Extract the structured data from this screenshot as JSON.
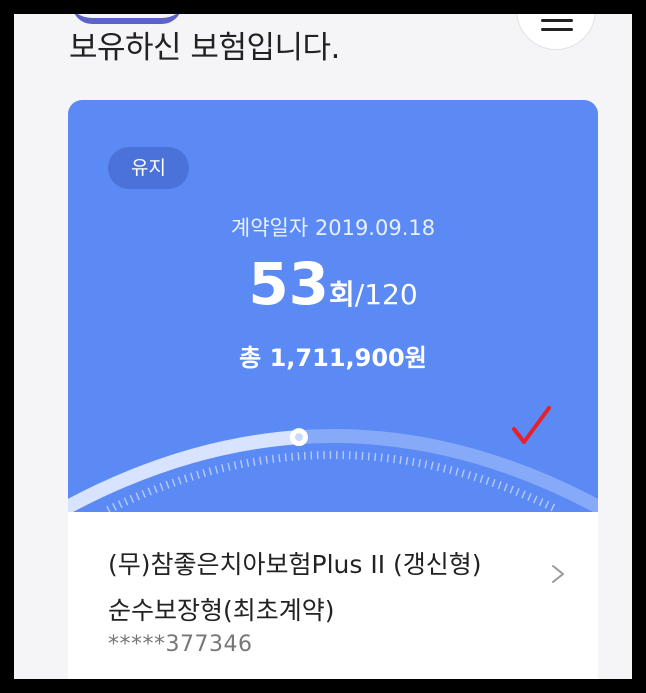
{
  "header": {
    "title": "보유하신 보험입니다."
  },
  "card": {
    "status_badge": "유지",
    "contract_date_label": "계약일자",
    "contract_date": "2019.09.18",
    "paid_count": "53",
    "paid_unit": "회",
    "total_count": "/120",
    "total_prefix": "총",
    "total_amount": "1,711,900",
    "total_suffix": "원",
    "progress_fraction": 0.44,
    "product_name_line1": "(무)참좋은치아보험Plus II (갱신형)",
    "product_name_line2": "순수보장형(최초계약)",
    "policy_number": "*****377346"
  },
  "colors": {
    "card_accent": "#5b8af5",
    "badge": "#4a72d9",
    "check_mark": "#e8202a"
  },
  "icons": {
    "menu": "hamburger-icon",
    "chevron": "chevron-right-icon",
    "check": "check-mark-icon"
  }
}
